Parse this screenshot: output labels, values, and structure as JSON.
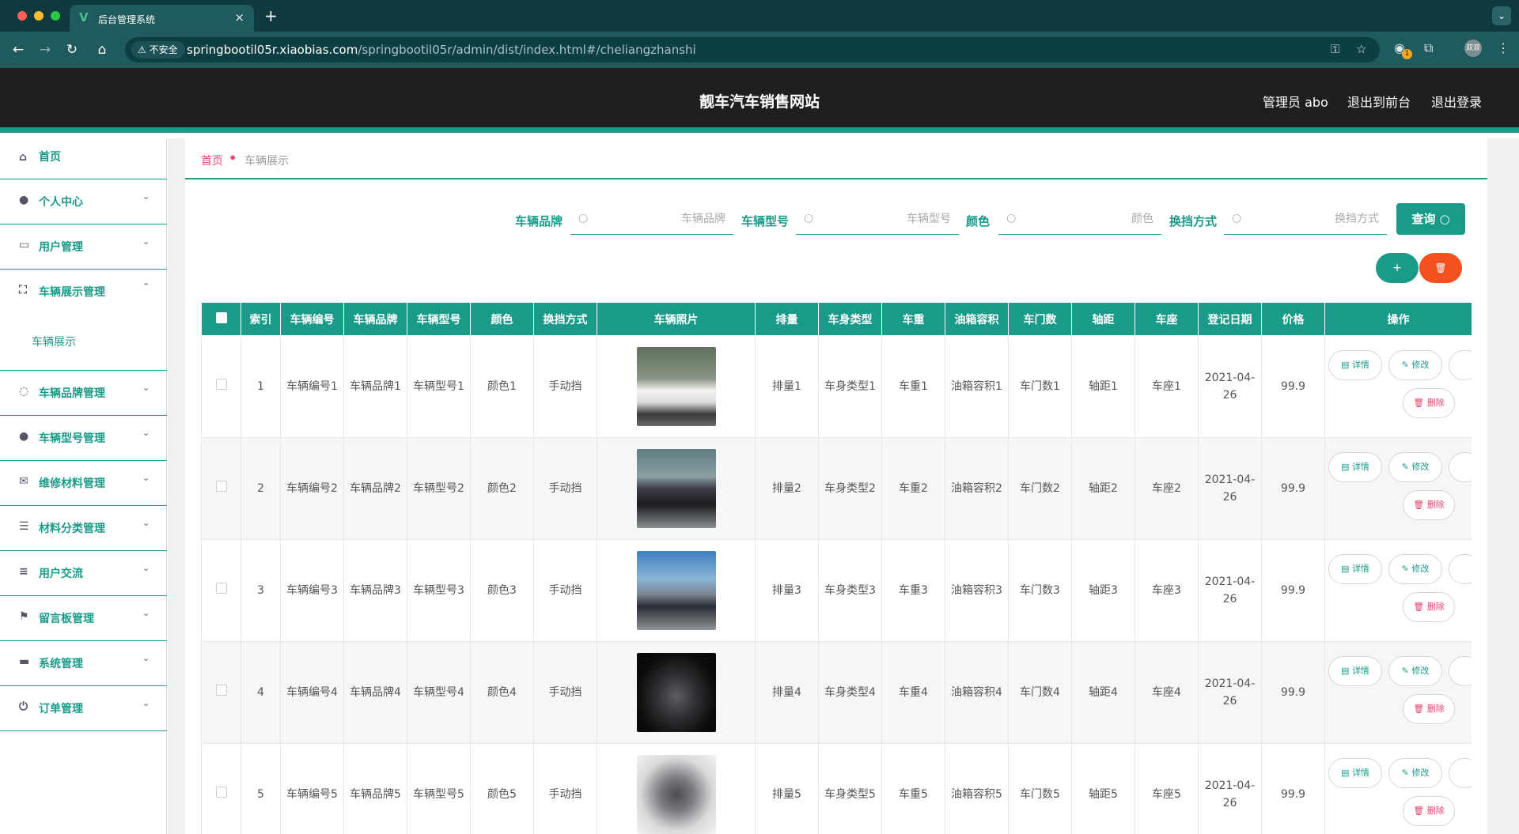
{
  "browser": {
    "tab_title": "后台管理系统",
    "insecure_label": "不安全",
    "url_host": "springbootil05r.xiaobias.com",
    "url_path": "/springbootil05r/admin/dist/index.html#/cheliangzhanshi",
    "extension_badge": "1",
    "profile_label": "双双"
  },
  "header": {
    "site_title": "靓车汽车销售网站",
    "user_label": "管理员 abo",
    "to_front_label": "退出到前台",
    "logout_label": "退出登录"
  },
  "sidebar": {
    "items": [
      {
        "label": "首页",
        "icon": "home-icon"
      },
      {
        "label": "个人中心",
        "icon": "user-icon"
      },
      {
        "label": "用户管理",
        "icon": "chat-icon"
      },
      {
        "label": "车辆展示管理",
        "icon": "fullscreen-icon"
      },
      {
        "label": "车辆品牌管理",
        "icon": "bell-off-icon"
      },
      {
        "label": "车辆型号管理",
        "icon": "bulb-icon"
      },
      {
        "label": "维修材料管理",
        "icon": "mail-icon"
      },
      {
        "label": "材料分类管理",
        "icon": "list-icon"
      },
      {
        "label": "用户交流",
        "icon": "sliders-icon"
      },
      {
        "label": "留言板管理",
        "icon": "flag-icon"
      },
      {
        "label": "系统管理",
        "icon": "monitor-icon"
      },
      {
        "label": "订单管理",
        "icon": "power-icon"
      }
    ],
    "sub_item": "车辆展示"
  },
  "breadcrumb": {
    "home": "首页",
    "current": "车辆展示"
  },
  "filters": {
    "brand_label": "车辆品牌",
    "brand_placeholder": "车辆品牌",
    "model_label": "车辆型号",
    "model_placeholder": "车辆型号",
    "color_label": "颜色",
    "color_placeholder": "颜色",
    "gear_label": "换挡方式",
    "gear_placeholder": "换挡方式",
    "search_label": "查询"
  },
  "actions": {
    "add_label": "+",
    "delete_label": "🗑"
  },
  "colors": {
    "accent": "#1a9b8a",
    "danger": "#f4511e",
    "header_bg": "#1f1f1f"
  },
  "table": {
    "columns": [
      "索引",
      "车辆编号",
      "车辆品牌",
      "车辆型号",
      "颜色",
      "换挡方式",
      "车辆照片",
      "排量",
      "车身类型",
      "车重",
      "油箱容积",
      "车门数",
      "轴距",
      "车座",
      "登记日期",
      "价格",
      "操作"
    ],
    "op_labels": {
      "detail": "详情",
      "edit": "修改",
      "delete": "删除"
    },
    "rows": [
      {
        "index": "1",
        "code": "车辆编号1",
        "brand": "车辆品牌1",
        "model": "车辆型号1",
        "color": "颜色1",
        "gear": "手动挡",
        "displacement": "排量1",
        "body": "车身类型1",
        "weight": "车重1",
        "tank": "油箱容积1",
        "doors": "车门数1",
        "wheelbase": "轴距1",
        "seats": "车座1",
        "date": "2021-04-26",
        "price": "99.9"
      },
      {
        "index": "2",
        "code": "车辆编号2",
        "brand": "车辆品牌2",
        "model": "车辆型号2",
        "color": "颜色2",
        "gear": "手动挡",
        "displacement": "排量2",
        "body": "车身类型2",
        "weight": "车重2",
        "tank": "油箱容积2",
        "doors": "车门数2",
        "wheelbase": "轴距2",
        "seats": "车座2",
        "date": "2021-04-26",
        "price": "99.9"
      },
      {
        "index": "3",
        "code": "车辆编号3",
        "brand": "车辆品牌3",
        "model": "车辆型号3",
        "color": "颜色3",
        "gear": "手动挡",
        "displacement": "排量3",
        "body": "车身类型3",
        "weight": "车重3",
        "tank": "油箱容积3",
        "doors": "车门数3",
        "wheelbase": "轴距3",
        "seats": "车座3",
        "date": "2021-04-26",
        "price": "99.9"
      },
      {
        "index": "4",
        "code": "车辆编号4",
        "brand": "车辆品牌4",
        "model": "车辆型号4",
        "color": "颜色4",
        "gear": "手动挡",
        "displacement": "排量4",
        "body": "车身类型4",
        "weight": "车重4",
        "tank": "油箱容积4",
        "doors": "车门数4",
        "wheelbase": "轴距4",
        "seats": "车座4",
        "date": "2021-04-26",
        "price": "99.9"
      },
      {
        "index": "5",
        "code": "车辆编号5",
        "brand": "车辆品牌5",
        "model": "车辆型号5",
        "color": "颜色5",
        "gear": "手动挡",
        "displacement": "排量5",
        "body": "车身类型5",
        "weight": "车重5",
        "tank": "油箱容积5",
        "doors": "车门数5",
        "wheelbase": "轴距5",
        "seats": "车座5",
        "date": "2021-04-26",
        "price": "99.9"
      }
    ]
  }
}
